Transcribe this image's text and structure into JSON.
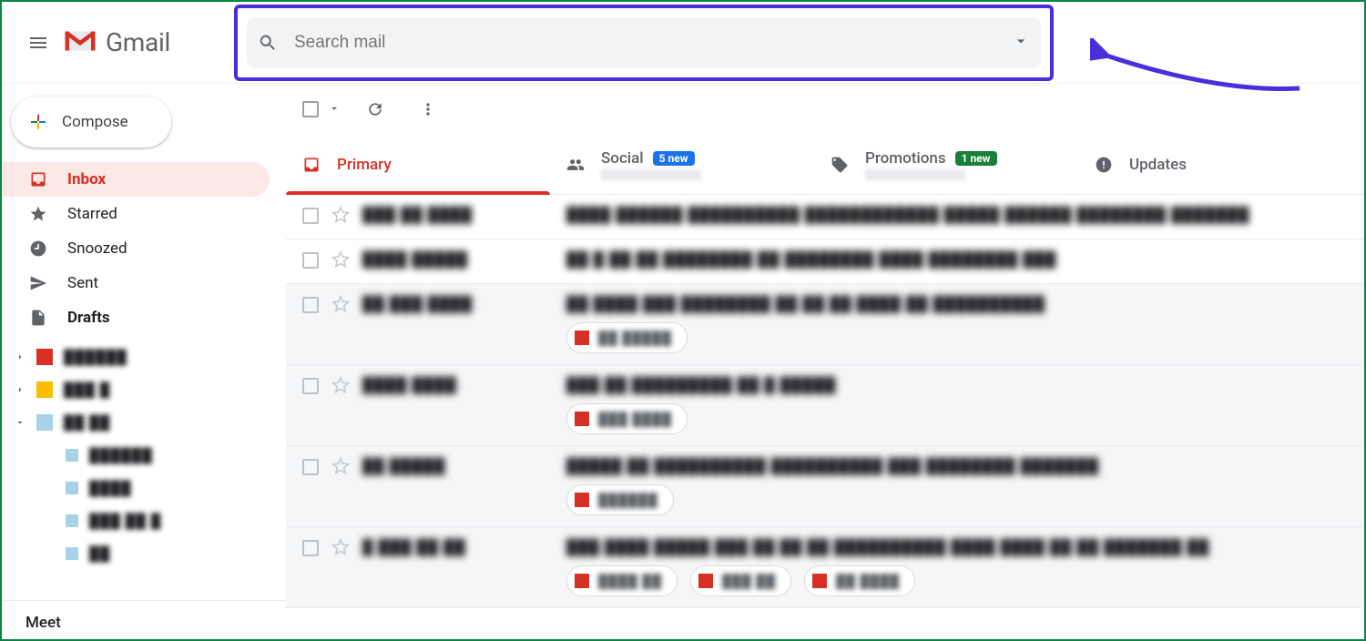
{
  "header": {
    "app_name": "Gmail",
    "search_placeholder": "Search mail"
  },
  "colors": {
    "highlight_box": "#4a2ddb",
    "accent_red": "#d93025",
    "badge_blue": "#1a73e8",
    "badge_green": "#188038"
  },
  "sidebar": {
    "compose_label": "Compose",
    "items": [
      {
        "icon": "inbox",
        "label": "Inbox",
        "active": true,
        "bold": true
      },
      {
        "icon": "star",
        "label": "Starred",
        "active": false,
        "bold": false
      },
      {
        "icon": "clock",
        "label": "Snoozed",
        "active": false,
        "bold": false
      },
      {
        "icon": "send",
        "label": "Sent",
        "active": false,
        "bold": false
      },
      {
        "icon": "file",
        "label": "Drafts",
        "active": false,
        "bold": true
      }
    ],
    "labels": [
      {
        "color": "#d93025",
        "text": "██████",
        "expand": "right",
        "child": false
      },
      {
        "color": "#fbbc04",
        "text": "███ █",
        "expand": "right",
        "child": false
      },
      {
        "color": "#a7d2e8",
        "text": "██ ██",
        "expand": "down",
        "child": false
      },
      {
        "color": "#a7d2e8",
        "text": "██████",
        "expand": null,
        "child": true
      },
      {
        "color": "#a7d2e8",
        "text": "████",
        "expand": null,
        "child": true
      },
      {
        "color": "#a7d2e8",
        "text": "███ ██ █",
        "expand": null,
        "child": true
      },
      {
        "color": "#a7d2e8",
        "text": "██",
        "expand": null,
        "child": true
      }
    ],
    "meet_label": "Meet"
  },
  "tabs": [
    {
      "icon": "primary",
      "title": "Primary",
      "active": true,
      "badge": null,
      "sub": false
    },
    {
      "icon": "social",
      "title": "Social",
      "active": false,
      "badge": {
        "text": "5 new",
        "style": "blue"
      },
      "sub": true
    },
    {
      "icon": "promotions",
      "title": "Promotions",
      "active": false,
      "badge": {
        "text": "1 new",
        "style": "green"
      },
      "sub": true
    },
    {
      "icon": "updates",
      "title": "Updates",
      "active": false,
      "badge": null,
      "sub": false
    }
  ],
  "emails": [
    {
      "unread": true,
      "sender": "███ ██ ████",
      "subject": "████ ██████ ██████████ ████████████ █████ ██████ ████████ ███████",
      "attachments": []
    },
    {
      "unread": true,
      "sender": "████ █████",
      "subject": "██ █ ██ ██ ████████ ██ ████████ ████ ████████ ███",
      "attachments": []
    },
    {
      "unread": false,
      "sender": "██ ███ ████",
      "subject": "██ ████ ███ ████████ ██ ██ ██ ████ ██ ██████████",
      "attachments": [
        {
          "color": "red",
          "label": "██ █████"
        }
      ]
    },
    {
      "unread": false,
      "sender": "████ ████",
      "subject": "███ ██ █████████ ██ █ █████",
      "attachments": [
        {
          "color": "red",
          "label": "███ ████"
        }
      ]
    },
    {
      "unread": false,
      "sender": "██ █████",
      "subject": "█████ ██ ██████████ ██████████ ███ ████████ ███████",
      "attachments": [
        {
          "color": "red",
          "label": "██████"
        }
      ]
    },
    {
      "unread": false,
      "sender": "█ ███ ██ ██",
      "subject": "███ ████ █████ ███ ██ ██ ██ ██████████ ████ ████ ██ ██ ███████ ██",
      "attachments": [
        {
          "color": "red",
          "label": "████ ██"
        },
        {
          "color": "red",
          "label": "███ ██"
        },
        {
          "color": "red",
          "label": "██ ████"
        }
      ]
    }
  ]
}
